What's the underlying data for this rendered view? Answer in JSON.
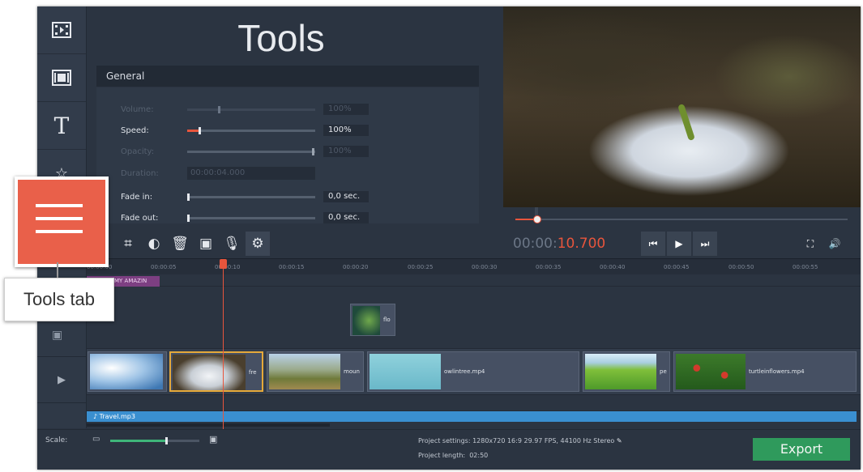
{
  "tools_panel": {
    "title": "Tools",
    "section": "General",
    "props": [
      {
        "label": "Volume:",
        "value": "100%",
        "enabled": false
      },
      {
        "label": "Speed:",
        "value": "100%",
        "enabled": true
      },
      {
        "label": "Opacity:",
        "value": "100%",
        "enabled": false
      },
      {
        "label": "Duration:",
        "value": "00:00:04.000",
        "enabled": false
      },
      {
        "label": "Fade in:",
        "value": "0,0 sec.",
        "enabled": true
      },
      {
        "label": "Fade out:",
        "value": "0,0 sec.",
        "enabled": true
      }
    ]
  },
  "toolbar": {
    "icons": [
      "rotate-icon",
      "crop-icon",
      "color-adjust-icon",
      "delete-icon",
      "image-icon",
      "microphone-icon",
      "gear-icon"
    ]
  },
  "player": {
    "timecode_prefix": "00:00:",
    "timecode_highlight": "10.700",
    "progress": 0.05
  },
  "ruler": [
    "00:00:00",
    "00:00:05",
    "00:00:10",
    "00:00:15",
    "00:00:20",
    "00:00:25",
    "00:00:30",
    "00:00:35",
    "00:00:40",
    "00:00:45",
    "00:00:50",
    "00:00:55"
  ],
  "timeline": {
    "title_clip": "MY AMAZIN",
    "overlay_clip": "flo",
    "video_clips": [
      "fre",
      "moun",
      "owlintree.mp4",
      "pe",
      "turtleinflowers.mp4"
    ],
    "audio_clip": "♪ Travel.mp3"
  },
  "bottom": {
    "scale_label": "Scale:",
    "scale_level": 0.64,
    "project_settings_label": "Project settings:",
    "project_settings_value": "1280x720 16:9 29.97 FPS, 44100 Hz Stereo",
    "project_length_label": "Project length:",
    "project_length_value": "02:50",
    "export_label": "Export"
  },
  "callout": {
    "label": "Tools tab"
  },
  "colors": {
    "accent": "#e8553c",
    "export": "#2f9a5c",
    "callout": "#e9604a"
  }
}
